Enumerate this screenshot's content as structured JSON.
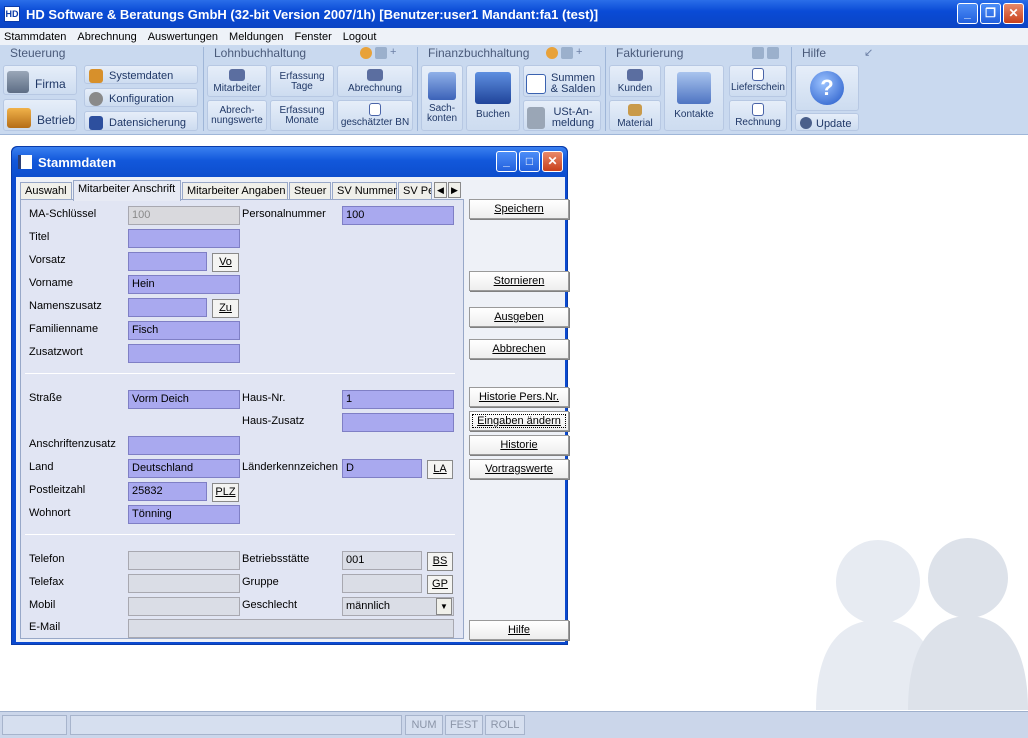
{
  "app": {
    "title": "HD Software & Beratungs GmbH (32-bit Version 2007/1h) [Benutzer:user1 Mandant:fa1 (test)]",
    "icon_label": "HD"
  },
  "menu": [
    "Stammdaten",
    "Abrechnung",
    "Auswertungen",
    "Meldungen",
    "Fenster",
    "Logout"
  ],
  "ribbon": {
    "groups": {
      "steuerung": "Steuerung",
      "lohn": "Lohnbuchhaltung",
      "finanz": "Finanzbuchhaltung",
      "faktur": "Fakturierung",
      "hilfe": "Hilfe"
    },
    "buttons": {
      "firma": "Firma",
      "betrieb": "Betrieb",
      "systemdaten": "Systemdaten",
      "konfiguration": "Konfiguration",
      "datensicherung": "Datensicherung",
      "mitarbeiter": "Mitarbeiter",
      "erfassung_tage": "Erfassung Tage",
      "abrechnung": "Abrechnung",
      "abrechnungswerte": "Abrech-nungswerte",
      "erfassung_monate": "Erfassung Monate",
      "geschaetzter_bn": "geschätzter BN",
      "sachkonten": "Sach-konten",
      "buchen": "Buchen",
      "summen_salden": "Summen & Salden",
      "ust_anmeldung": "USt-An-meldung",
      "kunden": "Kunden",
      "material": "Material",
      "kontakte": "Kontakte",
      "lieferschein": "Lieferschein",
      "rechnung": "Rechnung",
      "update": "Update"
    }
  },
  "window": {
    "title": "Stammdaten",
    "tabs": [
      "Auswahl",
      "Mitarbeiter Anschrift",
      "Mitarbeiter Angaben",
      "Steuer",
      "SV Nummer",
      "SV Pe"
    ],
    "active_tab": "Mitarbeiter Anschrift",
    "form": {
      "ma_schluessel": {
        "label": "MA-Schlüssel",
        "value": "100"
      },
      "personalnummer": {
        "label": "Personalnummer",
        "value": "100"
      },
      "titel": {
        "label": "Titel",
        "value": ""
      },
      "vorsatz": {
        "label": "Vorsatz",
        "value": "",
        "button": "Vo"
      },
      "vorname": {
        "label": "Vorname",
        "value": "Hein"
      },
      "namenszusatz": {
        "label": "Namenszusatz",
        "value": "",
        "button": "Zu"
      },
      "familienname": {
        "label": "Familienname",
        "value": "Fisch"
      },
      "zusatzwort": {
        "label": "Zusatzwort",
        "value": ""
      },
      "strasse": {
        "label": "Straße",
        "value": "Vorm Deich"
      },
      "haus_nr": {
        "label": "Haus-Nr.",
        "value": "1"
      },
      "haus_zusatz": {
        "label": "Haus-Zusatz",
        "value": ""
      },
      "anschriftenzusatz": {
        "label": "Anschriftenzusatz",
        "value": ""
      },
      "land": {
        "label": "Land",
        "value": "Deutschland"
      },
      "laenderkennzeichen": {
        "label": "Länderkennzeichen",
        "value": "D",
        "button": "LA"
      },
      "postleitzahl": {
        "label": "Postleitzahl",
        "value": "25832",
        "button": "PLZ"
      },
      "wohnort": {
        "label": "Wohnort",
        "value": "Tönning"
      },
      "telefon": {
        "label": "Telefon",
        "value": ""
      },
      "betriebsstaette": {
        "label": "Betriebsstätte",
        "value": "001",
        "button": "BS"
      },
      "telefax": {
        "label": "Telefax",
        "value": ""
      },
      "gruppe": {
        "label": "Gruppe",
        "value": "",
        "button": "GP"
      },
      "mobil": {
        "label": "Mobil",
        "value": ""
      },
      "geschlecht": {
        "label": "Geschlecht",
        "value": "männlich"
      },
      "email": {
        "label": "E-Mail",
        "value": ""
      }
    },
    "actions": {
      "speichern": "Speichern",
      "stornieren": "Stornieren",
      "ausgeben": "Ausgeben",
      "abbrechen": "Abbrechen",
      "historie_pers": "Historie Pers.Nr.",
      "eingaben_aendern": "Eingaben ändern",
      "historie": "Historie",
      "vortragswerte": "Vortragswerte",
      "hilfe": "Hilfe"
    }
  },
  "statusbar": {
    "num": "NUM",
    "fest": "FEST",
    "roll": "ROLL"
  },
  "colors": {
    "titlebar": "#0b4ad0",
    "ribbon": "#c9d9ef",
    "field": "#a9a9ef",
    "panel": "#e1e5f3"
  }
}
